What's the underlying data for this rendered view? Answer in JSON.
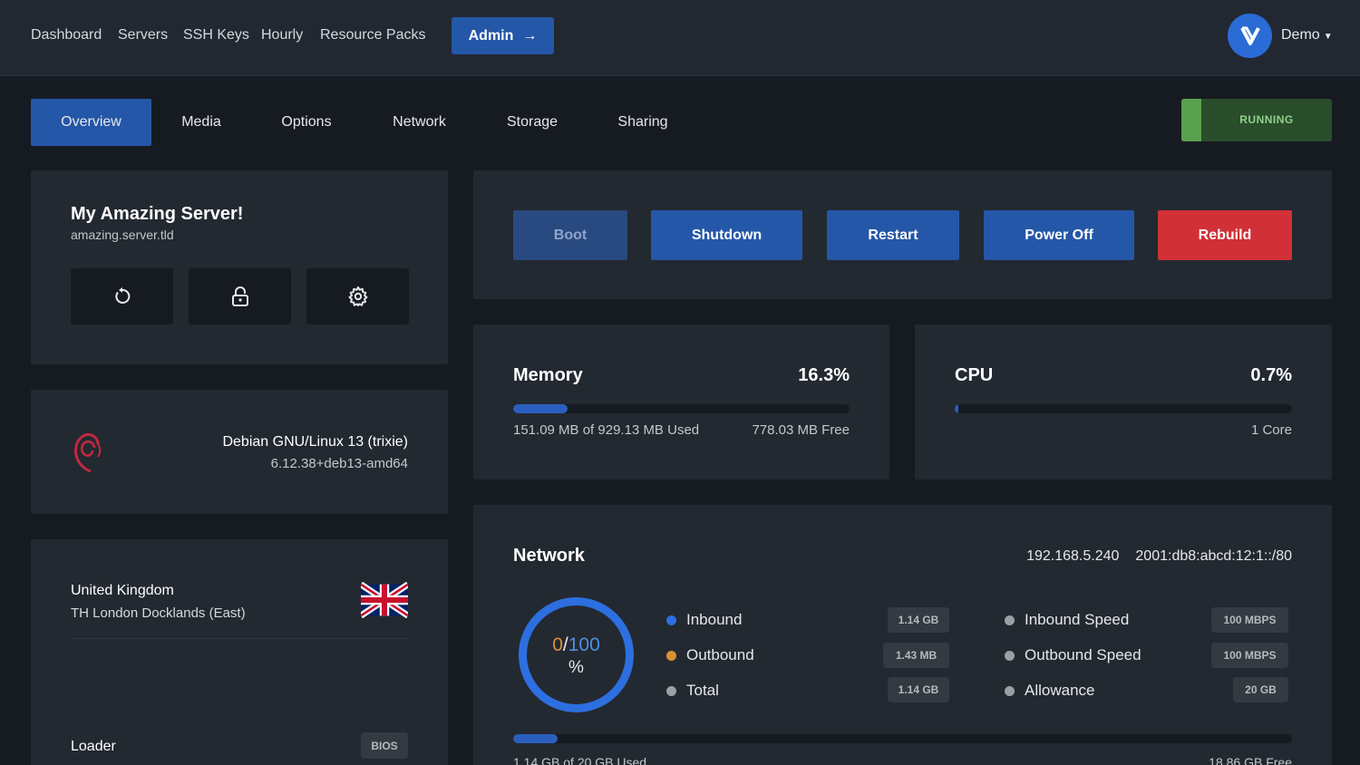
{
  "nav": {
    "links": [
      "Dashboard",
      "Servers",
      "SSH Keys",
      "Hourly",
      "Resource Packs"
    ],
    "admin_label": "Admin",
    "admin_arrow": "→",
    "user": "Demo",
    "avatar_icon": "v-logo-icon"
  },
  "tabs": [
    "Overview",
    "Media",
    "Options",
    "Network",
    "Storage",
    "Sharing"
  ],
  "status": "RUNNING",
  "server": {
    "name": "My Amazing Server!",
    "hostname": "amazing.server.tld",
    "icon_buttons": [
      "refresh-icon",
      "lock-icon",
      "gear-icon"
    ]
  },
  "os": {
    "name": "Debian GNU/Linux 13 (trixie)",
    "kernel": "6.12.38+deb13-amd64",
    "icon": "debian-logo-icon"
  },
  "location": {
    "country": "United Kingdom",
    "datacenter": "TH London Docklands (East)",
    "flag": "uk-flag-icon",
    "loader_label": "Loader",
    "loader_value": "BIOS"
  },
  "actions": {
    "boot": "Boot",
    "shutdown": "Shutdown",
    "restart": "Restart",
    "power_off": "Power Off",
    "rebuild": "Rebuild"
  },
  "memory": {
    "title": "Memory",
    "percent": "16.3%",
    "fill_fraction": 0.163,
    "used_text": "151.09 MB of 929.13 MB Used",
    "free_text": "778.03 MB Free"
  },
  "cpu": {
    "title": "CPU",
    "percent": "0.7%",
    "fill_fraction": 0.007,
    "cores": "1 Core"
  },
  "network": {
    "title": "Network",
    "ipv4": "192.168.5.240",
    "ipv6": "2001:db8:abcd:12:1::/80",
    "donut_used": "0",
    "donut_sep": "/",
    "donut_max": "100",
    "donut_unit": "%",
    "legend": [
      {
        "label": "Inbound",
        "value": "1.14 GB",
        "color": "#2d6fe0"
      },
      {
        "label": "Outbound",
        "value": "1.43 MB",
        "color": "#d89133"
      },
      {
        "label": "Total",
        "value": "1.14 GB",
        "color": "#9aa0a6"
      }
    ],
    "speeds": [
      {
        "label": "Inbound Speed",
        "value": "100 MBPS"
      },
      {
        "label": "Outbound Speed",
        "value": "100 MBPS"
      },
      {
        "label": "Allowance",
        "value": "20 GB"
      }
    ],
    "fill_fraction": 0.057,
    "used_text": "1.14 GB of 20 GB Used",
    "free_text": "18.86 GB Free"
  },
  "colors": {
    "accent": "#2557a8",
    "danger": "#d13036",
    "running": "#5aa14d"
  }
}
